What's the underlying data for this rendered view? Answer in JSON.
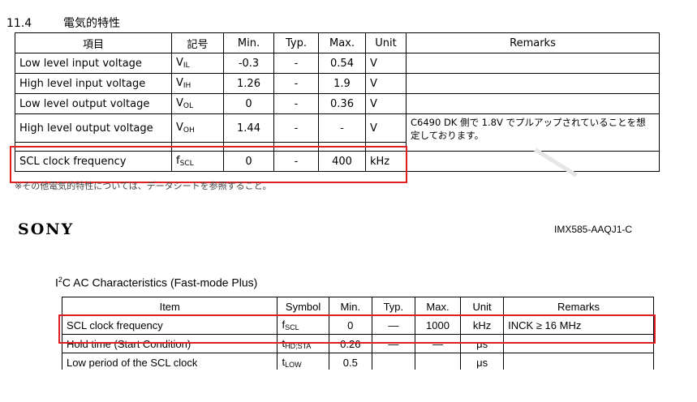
{
  "section": {
    "number": "11.4",
    "title": "電気的特性"
  },
  "table1": {
    "headers": [
      "項目",
      "記号",
      "Min.",
      "Typ.",
      "Max.",
      "Unit",
      "Remarks"
    ],
    "rows": [
      {
        "item": "Low level input voltage",
        "sym": "V",
        "sub": "IL",
        "min": "-0.3",
        "typ": "-",
        "max": "0.54",
        "unit": "V",
        "remarks": ""
      },
      {
        "item": "High level input voltage",
        "sym": "V",
        "sub": "IH",
        "min": "1.26",
        "typ": "-",
        "max": "1.9",
        "unit": "V",
        "remarks": ""
      },
      {
        "item": "Low level output voltage",
        "sym": "V",
        "sub": "OL",
        "min": "0",
        "typ": "-",
        "max": "0.36",
        "unit": "V",
        "remarks": ""
      },
      {
        "item": "High level output voltage",
        "sym": "V",
        "sub": "OH",
        "min": "1.44",
        "typ": "-",
        "max": "-",
        "unit": "V",
        "remarks": "C6490 DK 側で 1.8V でプルアップされていることを想定しております。"
      },
      {
        "item": "SCL clock frequency",
        "sym": "f",
        "sub": "SCL",
        "min": "0",
        "typ": "-",
        "max": "400",
        "unit": "kHz",
        "remarks": ""
      }
    ]
  },
  "footnote": "※その他電気的特性については、データシートを参照すること。",
  "brand": "SONY",
  "doc_number": "IMX585-AAQJ1-C",
  "subtitle": {
    "sup": "2",
    "prefix": "I",
    "text": "C AC Characteristics (Fast-mode Plus)"
  },
  "table2": {
    "headers": [
      "Item",
      "Symbol",
      "Min.",
      "Typ.",
      "Max.",
      "Unit",
      "Remarks"
    ],
    "rows": [
      {
        "item": "SCL clock frequency",
        "sym": "f",
        "sub": "SCL",
        "min": "0",
        "typ": "—",
        "max": "1000",
        "unit": "kHz",
        "remarks": "INCK ≥ 16 MHz"
      },
      {
        "item": "Hold time (Start Condition)",
        "sym": "t",
        "sub": "HD;STA",
        "min": "0.26",
        "typ": "—",
        "max": "—",
        "unit": "μs",
        "remarks": ""
      },
      {
        "item": "Low period of the SCL clock",
        "sym": "t",
        "sub": "LOW",
        "min": "0.5",
        "typ": "",
        "max": "",
        "unit": "μs",
        "remarks": ""
      }
    ]
  },
  "highlight_color": "#e02020"
}
